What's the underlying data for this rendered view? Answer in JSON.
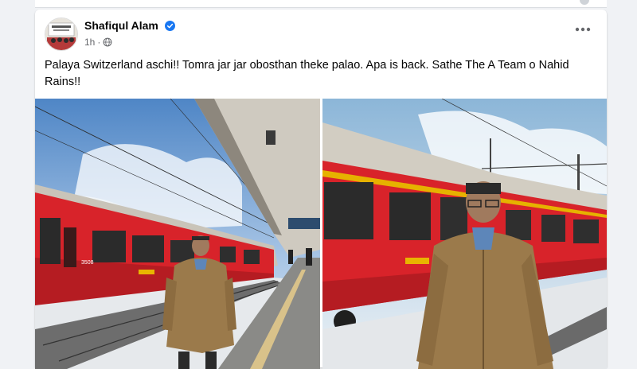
{
  "post": {
    "author_name": "Shafiqul Alam",
    "timestamp": "1h",
    "separator": "·",
    "audience_icon": "globe-icon",
    "verified_icon": "verified-badge-icon",
    "more_icon": "more-options-icon",
    "text": "Palaya Switzerland aschi!! Tomra jar jar obosthan theke palao. Apa is back. Sathe The A Team o Nahid Rains!!"
  },
  "photos": [
    {
      "name": "photo-left",
      "train_number": "3508"
    },
    {
      "name": "photo-right"
    }
  ],
  "colors": {
    "card_bg": "#ffffff",
    "page_bg": "#f0f2f5",
    "text": "#050505",
    "meta": "#65676b",
    "verified": "#1877f2",
    "train_red": "#d8232a",
    "jacket": "#9b7a4b"
  }
}
